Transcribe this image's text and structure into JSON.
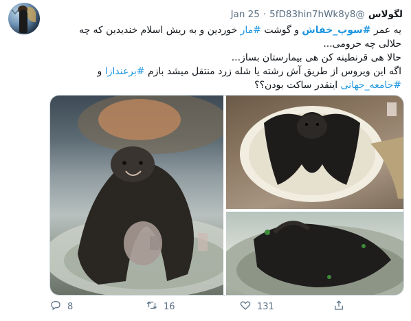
{
  "author": {
    "display_name": "لگولاس",
    "handle": "@5fD83hin7hWk8y8",
    "separator": "·",
    "date": "Jan 25"
  },
  "tweet": {
    "line1": {
      "before": "یه عمر ",
      "hashtag": "#سوپ_خفاش",
      "after": " و گوشت ",
      "hashtag2": "#مار",
      "after2": " خوردین و به ریش اسلام خندیدین که چه"
    },
    "line2": "حلالی چه حرومی...",
    "line3": "حالا هی قرنطینه کن هی بیمارستان بساز...",
    "line4": {
      "text": "اگه این ویروس از طریق آش رشته یا شله زرد منتقل میشد بازم ",
      "hashtag": "#برعندازا",
      "after": " و"
    },
    "line5": {
      "hashtag": "#جامعه_جهانی",
      "after": " اینقدر ساکت بودن؟؟"
    }
  },
  "media": {
    "photos": [
      "bat-soup-photo-1",
      "bat-soup-photo-2",
      "bat-soup-photo-3"
    ]
  },
  "actions": {
    "reply_count": "8",
    "retweet_count": "16",
    "like_count": "131"
  },
  "colors": {
    "link": "#1b95e0",
    "muted": "#5b7083",
    "text": "#0f1419"
  },
  "icons": {
    "menu": "chevron-down-icon",
    "reply": "reply-icon",
    "retweet": "retweet-icon",
    "like": "heart-icon",
    "share": "share-icon"
  }
}
